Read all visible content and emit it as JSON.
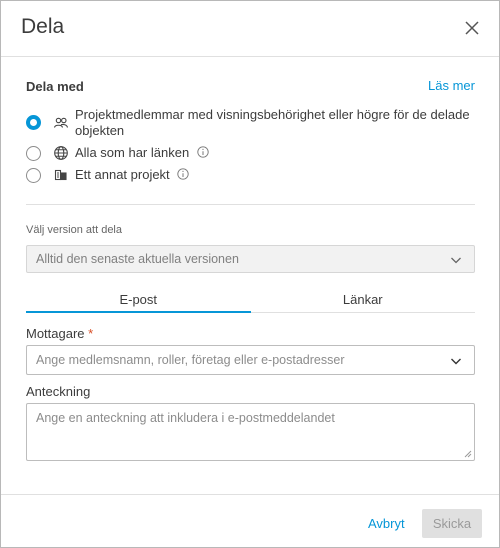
{
  "dialog": {
    "title": "Dela"
  },
  "share_with": {
    "label": "Dela med",
    "learn_more": "Läs mer",
    "options": [
      {
        "label": "Projektmedlemmar med visningsbehörighet eller högre för de delade",
        "label_line2": "objekten",
        "icon": "people-icon",
        "selected": true
      },
      {
        "label": "Alla som har länken",
        "icon": "globe-icon",
        "selected": false,
        "info": true
      },
      {
        "label": "Ett annat projekt",
        "icon": "project-icon",
        "selected": false,
        "info": true
      }
    ]
  },
  "version": {
    "label": "Välj version att dela",
    "selected": "Alltid den senaste aktuella versionen"
  },
  "tabs": [
    {
      "label": "E-post",
      "active": true
    },
    {
      "label": "Länkar",
      "active": false
    }
  ],
  "recipients": {
    "label": "Mottagare",
    "required_mark": "*",
    "placeholder": "Ange medlemsnamn, roller, företag eller e-postadresser"
  },
  "note": {
    "label": "Anteckning",
    "placeholder": "Ange en anteckning att inkludera i e-postmeddelandet"
  },
  "footer": {
    "cancel": "Avbryt",
    "send": "Skicka"
  },
  "colors": {
    "accent": "#0696d7",
    "required": "#d74e26",
    "disabled_bg": "#e0e0e0"
  }
}
